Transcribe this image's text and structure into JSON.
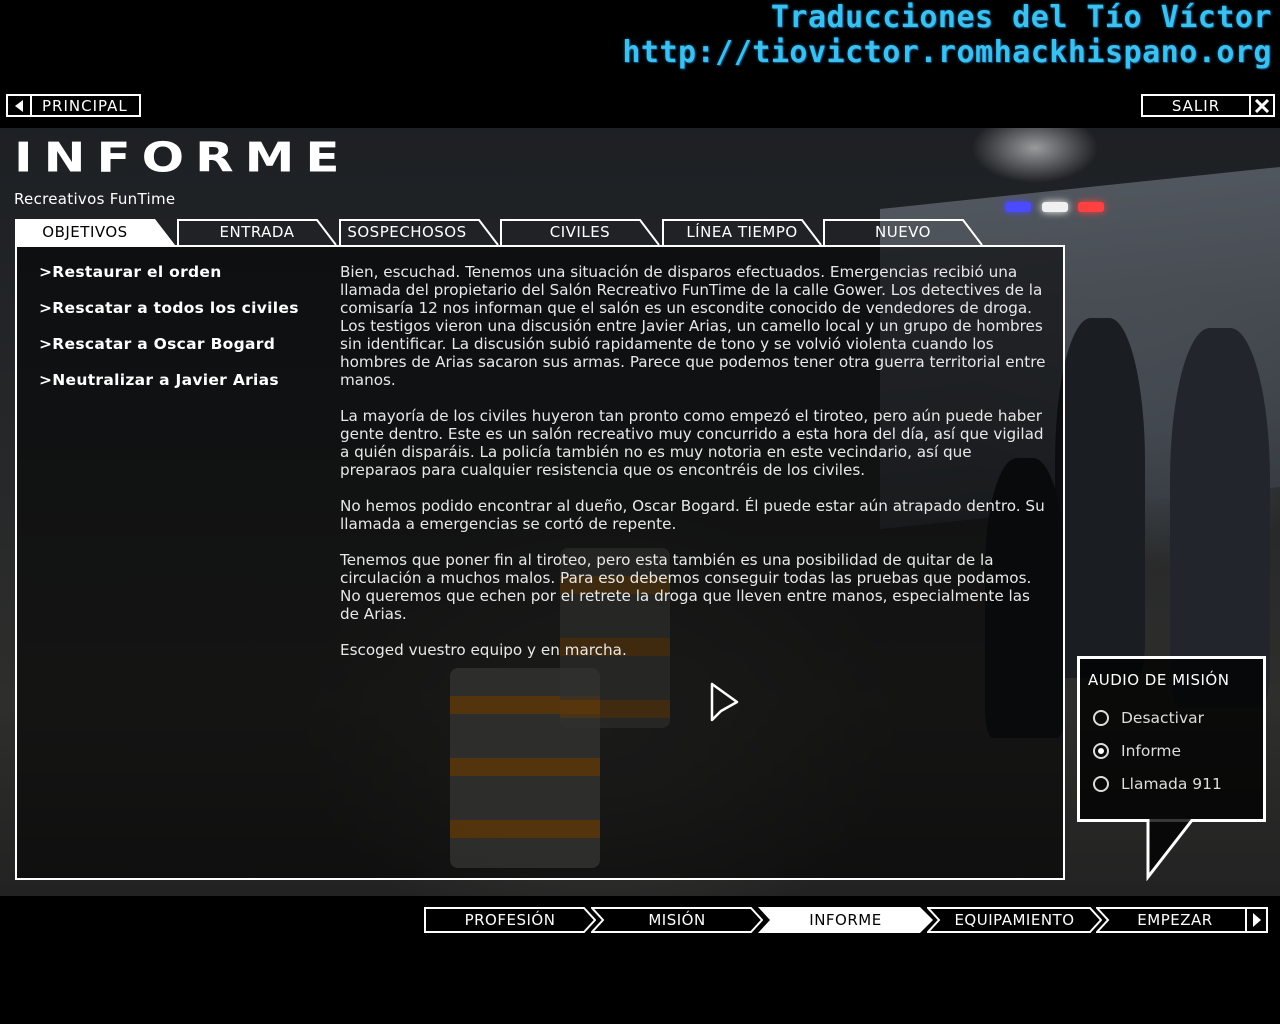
{
  "watermark": {
    "line1": "Traducciones del Tío Víctor",
    "line2": "http://tiovictor.romhackhispano.org"
  },
  "top": {
    "principal_label": "PRINCIPAL",
    "salir_label": "SALIR"
  },
  "page": {
    "title": "INFORME",
    "subtitle": "Recreativos FunTime"
  },
  "tabs": [
    {
      "label": "OBJETIVOS",
      "active": true
    },
    {
      "label": "ENTRADA",
      "active": false
    },
    {
      "label": "SOSPECHOSOS",
      "active": false
    },
    {
      "label": "CIVILES",
      "active": false
    },
    {
      "label": "LÍNEA TIEMPO",
      "active": false
    },
    {
      "label": "NUEVO",
      "active": false
    }
  ],
  "objectives": [
    ">Restaurar el orden",
    ">Rescatar a todos los civiles",
    ">Rescatar a Oscar Bogard",
    ">Neutralizar a Javier Arias"
  ],
  "briefing": [
    "Bien, escuchad. Tenemos una situación de disparos efectuados. Emergencias recibió una llamada del propietario del Salón Recreativo FunTime de la calle Gower. Los detectives de la comisaría 12 nos informan que el salón es un escondite conocido de vendedores de droga. Los testigos vieron una discusión entre Javier Arias, un camello local y un grupo de hombres sin identificar. La discusión subió rapidamente de tono y se volvió violenta cuando los hombres de Arias sacaron sus armas. Parece que podemos tener otra guerra territorial entre manos.",
    "La mayoría de los civiles huyeron tan pronto como empezó el tiroteo, pero aún puede haber gente dentro. Este es un salón recreativo muy concurrido a esta hora del día, así que vigilad a quién disparáis. La policía también no es muy notoria en este vecindario, así que preparaos para cualquier resistencia que os encontréis de los civiles.",
    "No hemos podido encontrar al dueño, Oscar Bogard. Él puede estar aún atrapado dentro. Su llamada a emergencias se cortó de repente.",
    "Tenemos que poner fin al tiroteo, pero esta también es una posibilidad de quitar de la circulación a muchos malos. Para eso debemos conseguir todas las pruebas que podamos. No queremos que echen por el retrete la droga que lleven entre manos, especialmente las de Arias.",
    "Escoged vuestro equipo y en marcha."
  ],
  "audio": {
    "heading": "AUDIO DE MISIÓN",
    "options": [
      {
        "label": "Desactivar",
        "selected": false
      },
      {
        "label": "Informe",
        "selected": true
      },
      {
        "label": "Llamada 911",
        "selected": false
      }
    ]
  },
  "bottom_nav": [
    {
      "label": "PROFESIÓN",
      "active": false
    },
    {
      "label": "MISIÓN",
      "active": false
    },
    {
      "label": "INFORME",
      "active": true
    },
    {
      "label": "EQUIPAMIENTO",
      "active": false
    },
    {
      "label": "EMPEZAR",
      "active": false
    }
  ],
  "colors": {
    "watermark": "#3cc0ee",
    "siren_blue": "#4a4aff",
    "siren_red": "#ff4040"
  }
}
